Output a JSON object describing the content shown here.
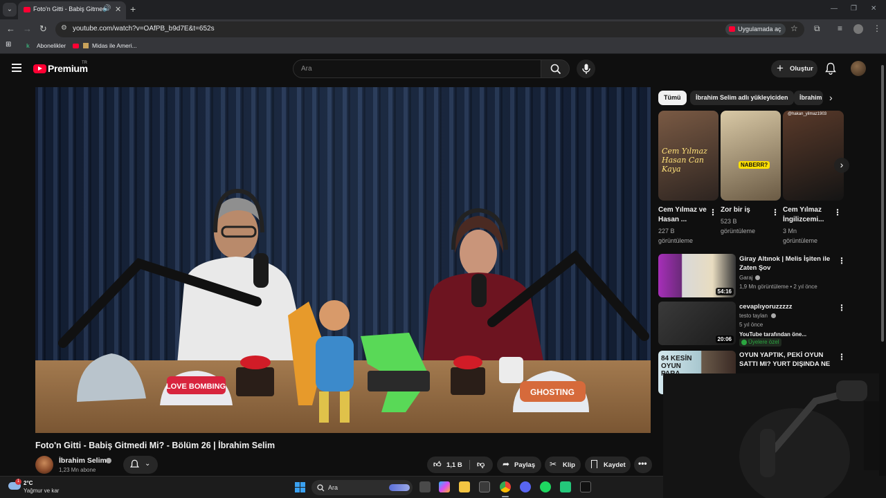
{
  "browser": {
    "tab_title": "Foto'n Gitti - Babiş Gitmedi",
    "url": "youtube.com/watch?v=OAfPB_b9d7E&t=652s",
    "open_in_app": "Uygulamada aç",
    "bookmarks": [
      "Abonelikler",
      "Midas ile Ameri..."
    ]
  },
  "header": {
    "logo": "Premium",
    "region": "TR",
    "search_placeholder": "Ara",
    "create_label": "Oluştur"
  },
  "video": {
    "title": "Foto'n Gitti - Babiş Gitmedi Mi? - Bölüm 26 | İbrahim Selim",
    "channel": "İbrahim Selim",
    "subscribers": "1,23 Mn abone",
    "likes": "1,1 B",
    "share": "Paylaş",
    "clip": "Klip",
    "save": "Kaydet",
    "prop_caps": [
      "LOVE BOMBING",
      "GHOSTING"
    ]
  },
  "chips": [
    "Tümü",
    "İbrahim Selim adlı yükleyiciden",
    "İbrahim"
  ],
  "shorts": [
    {
      "title": "Cem Yılmaz ve Hasan ...",
      "views": "227 B görüntüleme",
      "thumb_text": "Cem Yılmaz Hasan Can Kaya"
    },
    {
      "title": "Zor bir iş",
      "views": "523 B görüntüleme",
      "thumb_text": "NABERR?"
    },
    {
      "title": "Cem Yılmaz İngilizcemi...",
      "views": "3 Mn görüntüleme",
      "thumb_text": "@hakan_yilmaz1903"
    }
  ],
  "recommendations": [
    {
      "title": "Giray Altınok | Melis İşiten ile Zaten Şov",
      "channel": "Garaj",
      "meta": "1,9 Mn görüntüleme • 2 yıl önce",
      "duration": "54:16"
    },
    {
      "title": "cevaplıyoruzzzzz",
      "channel": "testo taylan",
      "meta": "5 yıl önce",
      "extra": "YouTube tarafından öne...",
      "badge": "Üyelere özel",
      "duration": "20:06"
    },
    {
      "title": "OYUN YAPTIK, PEKİ OYUN SATTI MI? YURT DIŞINDA NE ...",
      "channel": "",
      "meta": "",
      "thumb_text": "84 KESİN OYUN PARA"
    }
  ],
  "taskbar": {
    "temperature": "2°C",
    "weather": "Yağmur ve kar",
    "search": "Ara",
    "notif_count": "1"
  },
  "colors": {
    "youtube_red": "#ff0033",
    "background": "#0f0f0f",
    "chip_bg": "#272727"
  }
}
